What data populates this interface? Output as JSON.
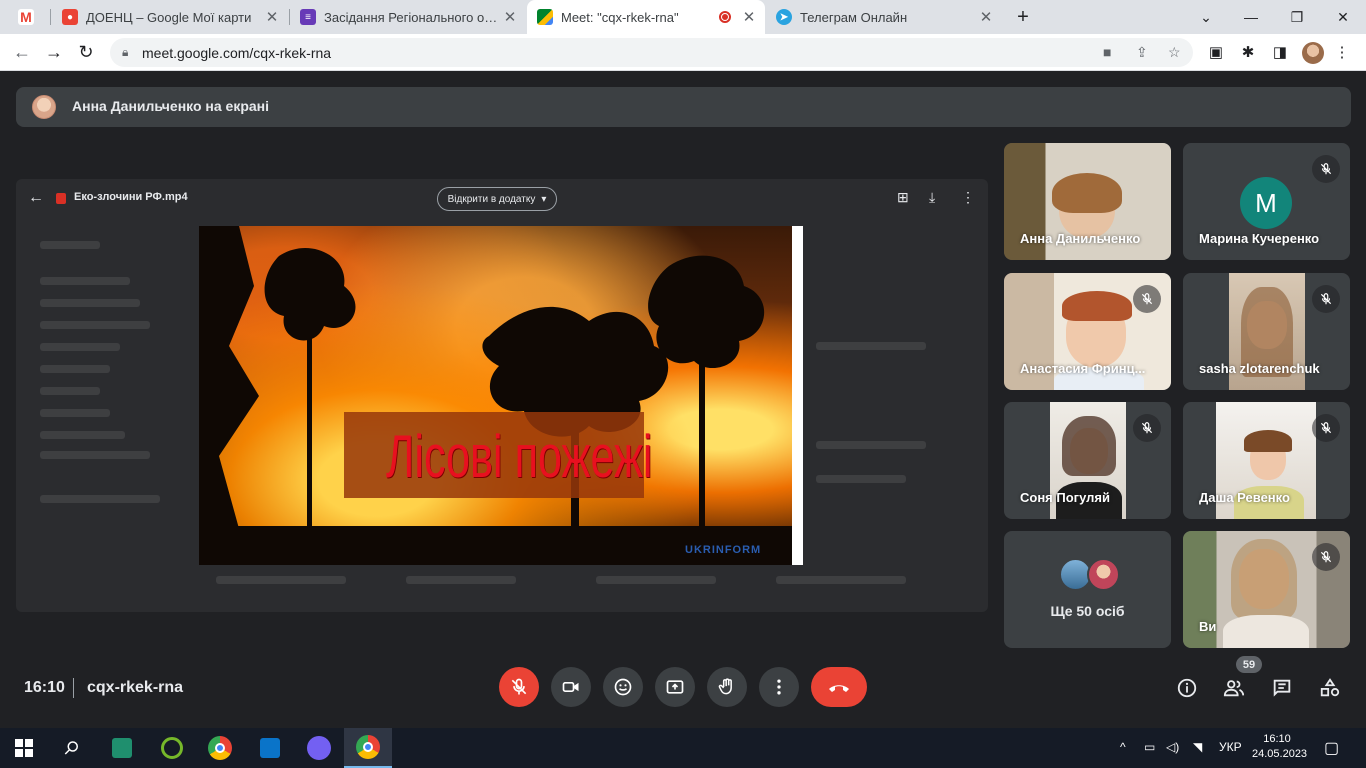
{
  "browser": {
    "tabs": [
      {
        "label": "",
        "icon": "gmail-icon"
      },
      {
        "label": "ДОЕНЦ – Google Мої карти",
        "icon": "maps-icon"
      },
      {
        "label": "Засідання Регіонального осеред",
        "icon": "forms-icon"
      },
      {
        "label": "Meet: \"cqx-rkek-rna\"",
        "icon": "meet-icon"
      },
      {
        "label": "Телеграм Онлайн",
        "icon": "telegram-icon"
      }
    ],
    "url": "meet.google.com/cqx-rkek-rna"
  },
  "presenter": {
    "text": "Анна Данильченко на екрані"
  },
  "share": {
    "file_title": "Еко-злочини РФ.mp4",
    "open_with": "Відкрити в додатку",
    "video_title": "Лісові пожежі",
    "watermark": "UKRINFORM"
  },
  "participants": [
    {
      "name": "Анна Данильченко",
      "muted": false
    },
    {
      "name": "Марина Кучеренко",
      "muted": true,
      "initial": "M"
    },
    {
      "name": "Анастасия Фринц...",
      "muted": true
    },
    {
      "name": "sasha zlotarenchuk",
      "muted": true
    },
    {
      "name": "Соня Погуляй",
      "muted": true
    },
    {
      "name": "Даша Ревенко",
      "muted": true
    },
    {
      "name": "Ви",
      "muted": true
    }
  ],
  "more": {
    "label": "Ще 50 осіб"
  },
  "meeting": {
    "time": "16:10",
    "code": "cqx-rkek-rna",
    "participant_count": "59"
  },
  "taskbar": {
    "lang": "УКР",
    "time": "16:10",
    "date": "24.05.2023"
  },
  "colors": {
    "meet_bg": "#202124",
    "tile_bg": "#3c4043",
    "danger": "#ea4335",
    "avatar_teal": "#12857a"
  }
}
